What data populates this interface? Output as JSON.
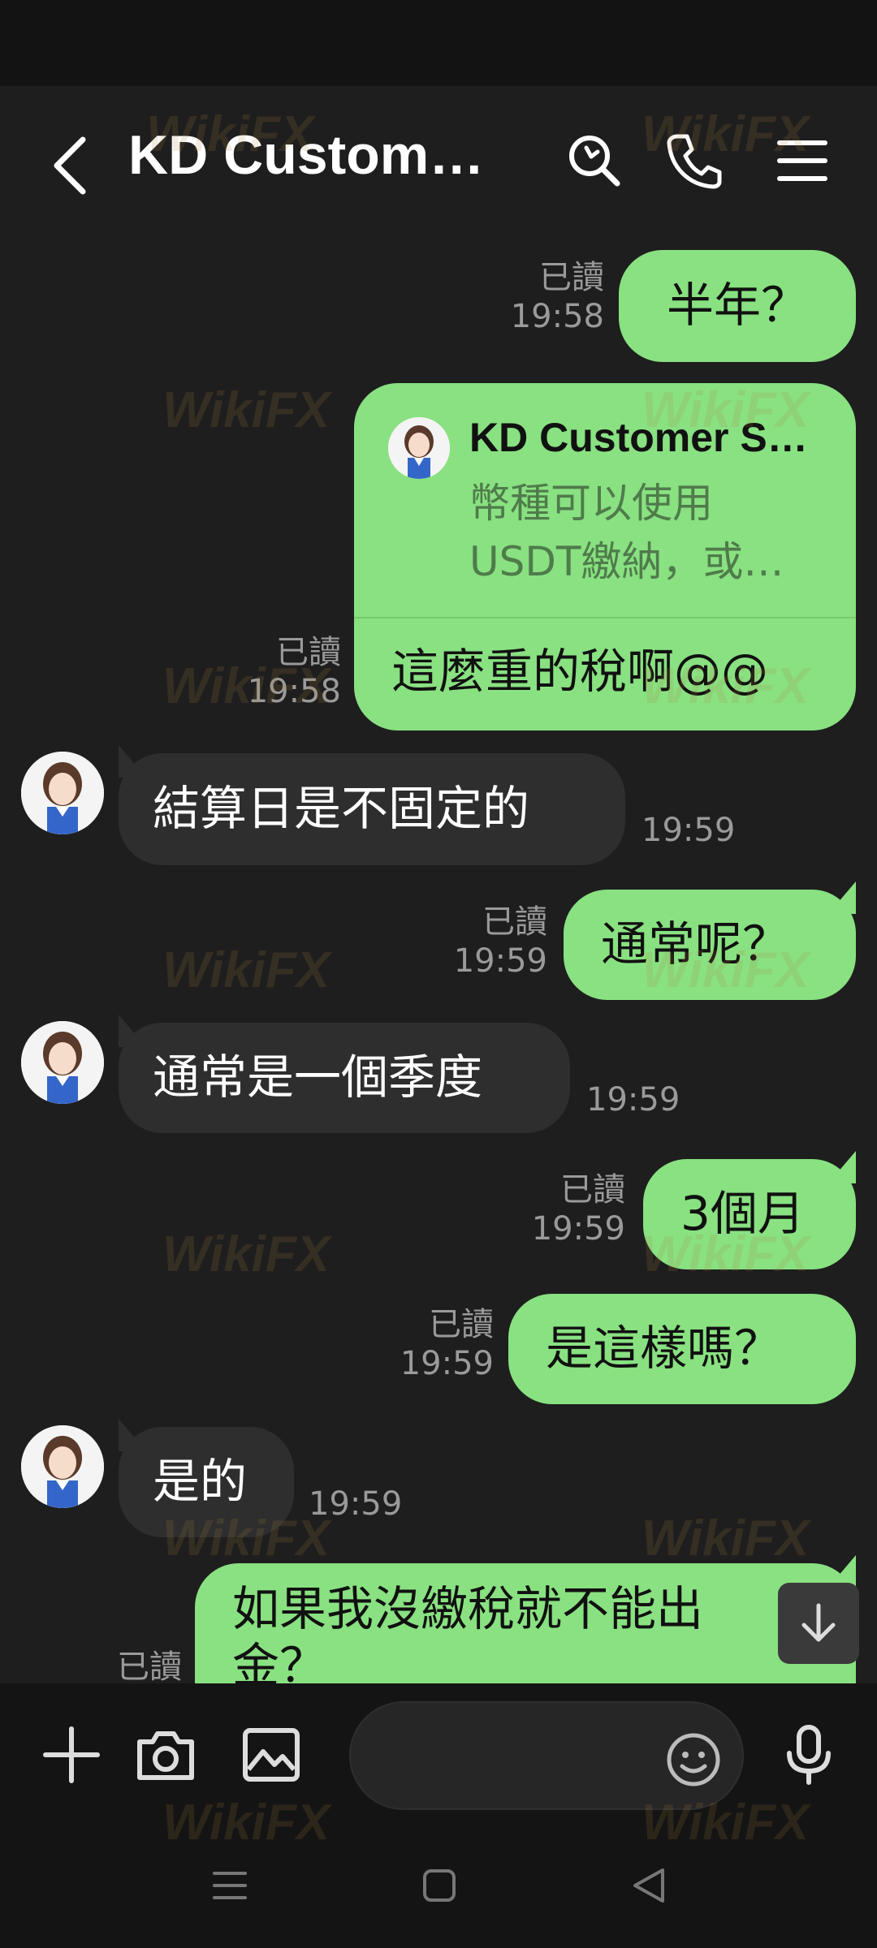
{
  "header": {
    "title": "KD Custom…",
    "back_icon": "chevron-left-icon",
    "icons": [
      "search-icon",
      "phone-icon",
      "menu-icon"
    ]
  },
  "messages": [
    {
      "side": "me",
      "text": "半年？",
      "read": "已讀",
      "time": "19:58"
    },
    {
      "side": "me",
      "type": "reply",
      "quote_name": "KD Customer S…",
      "quote_line1": "幣種可以使用",
      "quote_line2": "USDT繳納，或…",
      "text": "這麼重的稅啊@@",
      "read": "已讀",
      "time": "19:58"
    },
    {
      "side": "them",
      "text": "結算日是不固定的",
      "time": "19:59"
    },
    {
      "side": "me",
      "text": "通常呢？",
      "read": "已讀",
      "time": "19:59"
    },
    {
      "side": "them",
      "text": "通常是一個季度",
      "time": "19:59"
    },
    {
      "side": "me",
      "text": "3個月",
      "read": "已讀",
      "time": "19:59"
    },
    {
      "side": "me",
      "text": "是這樣嗎？",
      "read": "已讀",
      "time": "19:59"
    },
    {
      "side": "them",
      "text": "是的",
      "time": "19:59"
    },
    {
      "side": "me",
      "text": "如果我沒繳稅就不能出",
      "text_line2": "金？",
      "read": "已讀"
    }
  ],
  "input": {
    "placeholder": ""
  },
  "watermark": "WikiFX",
  "colors": {
    "my_bubble": "#89e181",
    "their_bubble": "#2e2e2e",
    "background": "#1e1e1e"
  }
}
